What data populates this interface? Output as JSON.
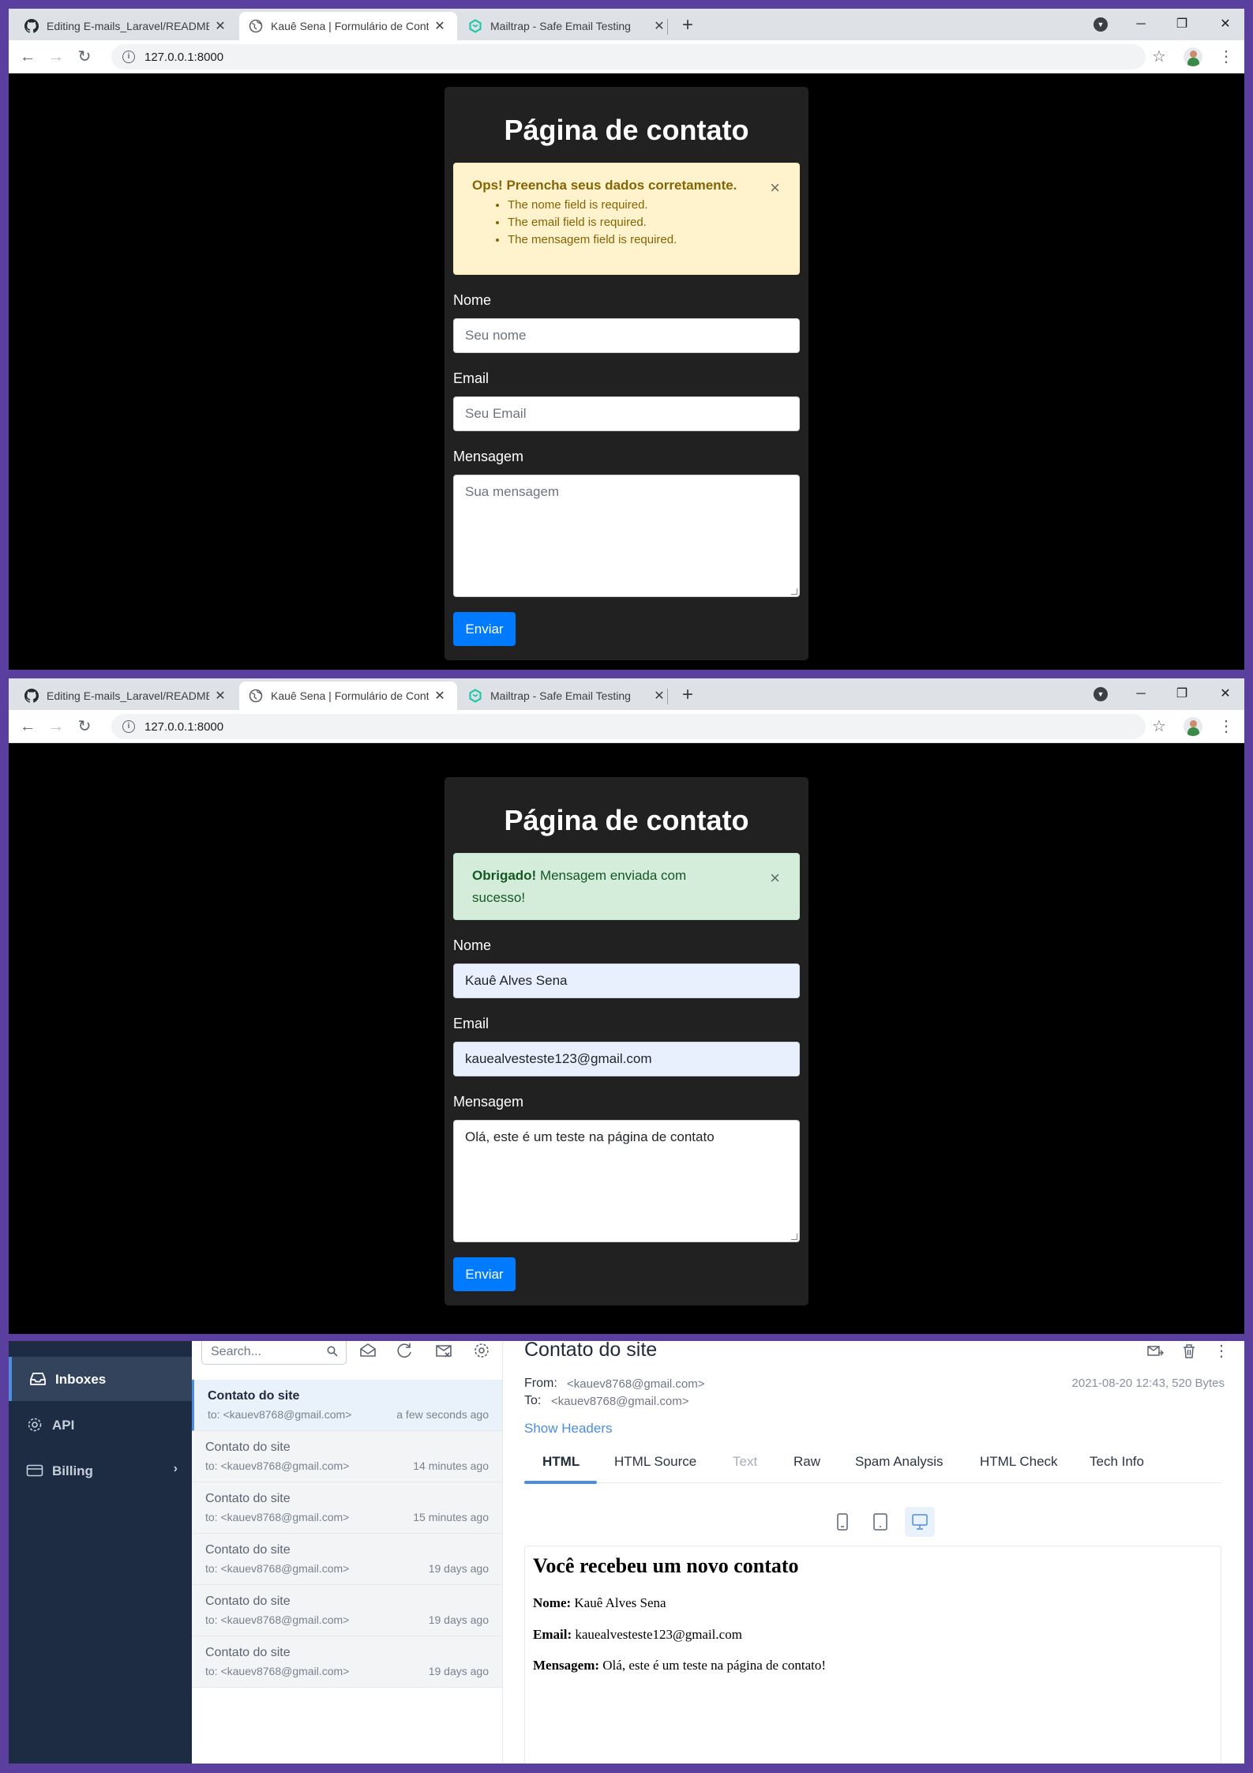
{
  "browser": {
    "tabs": [
      {
        "title": "Editing E-mails_Laravel/README.",
        "icon": "github-icon"
      },
      {
        "title": "Kauê Sena | Formulário de Conta",
        "icon": "globe-icon"
      },
      {
        "title": "Mailtrap - Safe Email Testing",
        "icon": "mailtrap-icon"
      }
    ],
    "url": "127.0.0.1:8000"
  },
  "form_error": {
    "page_title": "Página de contato",
    "alert": {
      "heading": "Ops! Preencha seus dados corretamente.",
      "errors": [
        "The nome field is required.",
        "The email field is required.",
        "The mensagem field is required."
      ],
      "close": "×"
    },
    "fields": {
      "nome_label": "Nome",
      "nome_placeholder": "Seu nome",
      "email_label": "Email",
      "email_placeholder": "Seu Email",
      "mensagem_label": "Mensagem",
      "mensagem_placeholder": "Sua mensagem"
    },
    "submit": "Enviar"
  },
  "form_success": {
    "page_title": "Página de contato",
    "alert": {
      "strong": "Obrigado!",
      "text": " Mensagem enviada com sucesso!",
      "close": "×"
    },
    "fields": {
      "nome_label": "Nome",
      "nome_value": "Kauê Alves Sena",
      "email_label": "Email",
      "email_value": "kauealvesteste123@gmail.com",
      "mensagem_label": "Mensagem",
      "mensagem_value": "Olá, este é um teste na página de contato"
    },
    "submit": "Enviar"
  },
  "mailtrap": {
    "sidebar": [
      {
        "label": "Inboxes",
        "icon": "inbox-icon"
      },
      {
        "label": "API",
        "icon": "gear-icon"
      },
      {
        "label": "Billing",
        "icon": "credit-card-icon"
      }
    ],
    "search_placeholder": "Search...",
    "messages": [
      {
        "subject": "Contato do site",
        "to": "to: <kauev8768@gmail.com>",
        "time": "a few seconds ago"
      },
      {
        "subject": "Contato do site",
        "to": "to: <kauev8768@gmail.com>",
        "time": "14 minutes ago"
      },
      {
        "subject": "Contato do site",
        "to": "to: <kauev8768@gmail.com>",
        "time": "15 minutes ago"
      },
      {
        "subject": "Contato do site",
        "to": "to: <kauev8768@gmail.com>",
        "time": "19 days ago"
      },
      {
        "subject": "Contato do site",
        "to": "to: <kauev8768@gmail.com>",
        "time": "19 days ago"
      },
      {
        "subject": "Contato do site",
        "to": "to: <kauev8768@gmail.com>",
        "time": "19 days ago"
      }
    ],
    "detail": {
      "subject": "Contato do site",
      "from_label": "From:",
      "from": "<kauev8768@gmail.com>",
      "to_label": "To:",
      "to": "<kauev8768@gmail.com>",
      "date": "2021-08-20 12:43, 520 Bytes",
      "show_headers": "Show Headers",
      "tabs": [
        "HTML",
        "HTML Source",
        "Text",
        "Raw",
        "Spam Analysis",
        "HTML Check",
        "Tech Info"
      ],
      "email": {
        "heading": "Você recebeu um novo contato",
        "nome_label": "Nome:",
        "nome": " Kauê Alves Sena",
        "email_label": "Email:",
        "email": " kauealvesteste123@gmail.com",
        "mensagem_label": "Mensagem:",
        "mensagem": " Olá, este é um teste na página de contato!"
      }
    },
    "colors": {
      "sidebar": "#1d2c42",
      "accent": "#4c8ddf"
    }
  }
}
